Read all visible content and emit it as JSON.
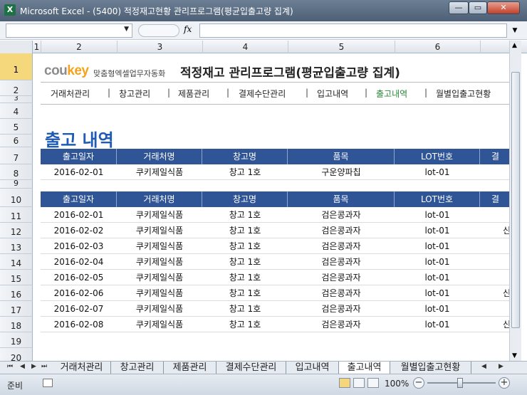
{
  "window": {
    "title": "Microsoft Excel - (5400) 적정재고현황 관리프로그램(평균입출고량 집계)",
    "app_icon": "X",
    "minimize": "—",
    "restore": "▭",
    "close": "✕"
  },
  "formula_bar": {
    "name_box": "",
    "fx": "fx",
    "formula": ""
  },
  "columns": [
    "1",
    "2",
    "3",
    "4",
    "5",
    "6"
  ],
  "rows": [
    "1",
    "2",
    "3",
    "4",
    "5",
    "6",
    "7",
    "8",
    "9",
    "10",
    "11",
    "12",
    "13",
    "14",
    "15",
    "16",
    "17",
    "18",
    "19",
    "20"
  ],
  "header": {
    "logo_co": "cou",
    "logo_key": "key",
    "logo_sub": "맞춤형엑셀업무자동화",
    "app_title": "적정재고 관리프로그램(평균입출고량 집계)"
  },
  "nav": [
    "거래처관리",
    "창고관리",
    "제품관리",
    "결제수단관리",
    "입고내역",
    "출고내역",
    "월별입출고현황"
  ],
  "section_title": "출고 내역",
  "table_headers": [
    "출고일자",
    "거래처명",
    "창고명",
    "품목",
    "LOT번호",
    "결"
  ],
  "input_row": [
    "2016-02-01",
    "쿠키제일식품",
    "창고 1호",
    "구운양파칩",
    "lot-01",
    ""
  ],
  "list_rows": [
    [
      "2016-02-01",
      "쿠키제일식품",
      "창고 1호",
      "검은콩과자",
      "lot-01",
      ""
    ],
    [
      "2016-02-02",
      "쿠키제일식품",
      "창고 1호",
      "검은콩과자",
      "lot-01",
      "신"
    ],
    [
      "2016-02-03",
      "쿠키제일식품",
      "창고 1호",
      "검은콩과자",
      "lot-01",
      ""
    ],
    [
      "2016-02-04",
      "쿠키제일식품",
      "창고 1호",
      "검은콩과자",
      "lot-01",
      ""
    ],
    [
      "2016-02-05",
      "쿠키제일식품",
      "창고 1호",
      "검은콩과자",
      "lot-01",
      ""
    ],
    [
      "2016-02-06",
      "쿠키제일식품",
      "창고 1호",
      "검은콩과자",
      "lot-01",
      "신"
    ],
    [
      "2016-02-07",
      "쿠키제일식품",
      "창고 1호",
      "검은콩과자",
      "lot-01",
      ""
    ],
    [
      "2016-02-08",
      "쿠키제일식품",
      "창고 1호",
      "검은콩과자",
      "lot-01",
      "신"
    ]
  ],
  "sheet_tabs": [
    "거래처관리",
    "창고관리",
    "제품관리",
    "결제수단관리",
    "입고내역",
    "출고내역",
    "월별입출고현황"
  ],
  "active_tab": "출고내역",
  "status": {
    "ready": "준비",
    "zoom": "100%",
    "zoom_minus": "−",
    "zoom_plus": "+"
  },
  "colors": {
    "table_header_bg": "#2f5597",
    "section_title": "#1f5bb5",
    "active_nav": "#2a8a3c",
    "logo_key": "#f6a21b"
  }
}
